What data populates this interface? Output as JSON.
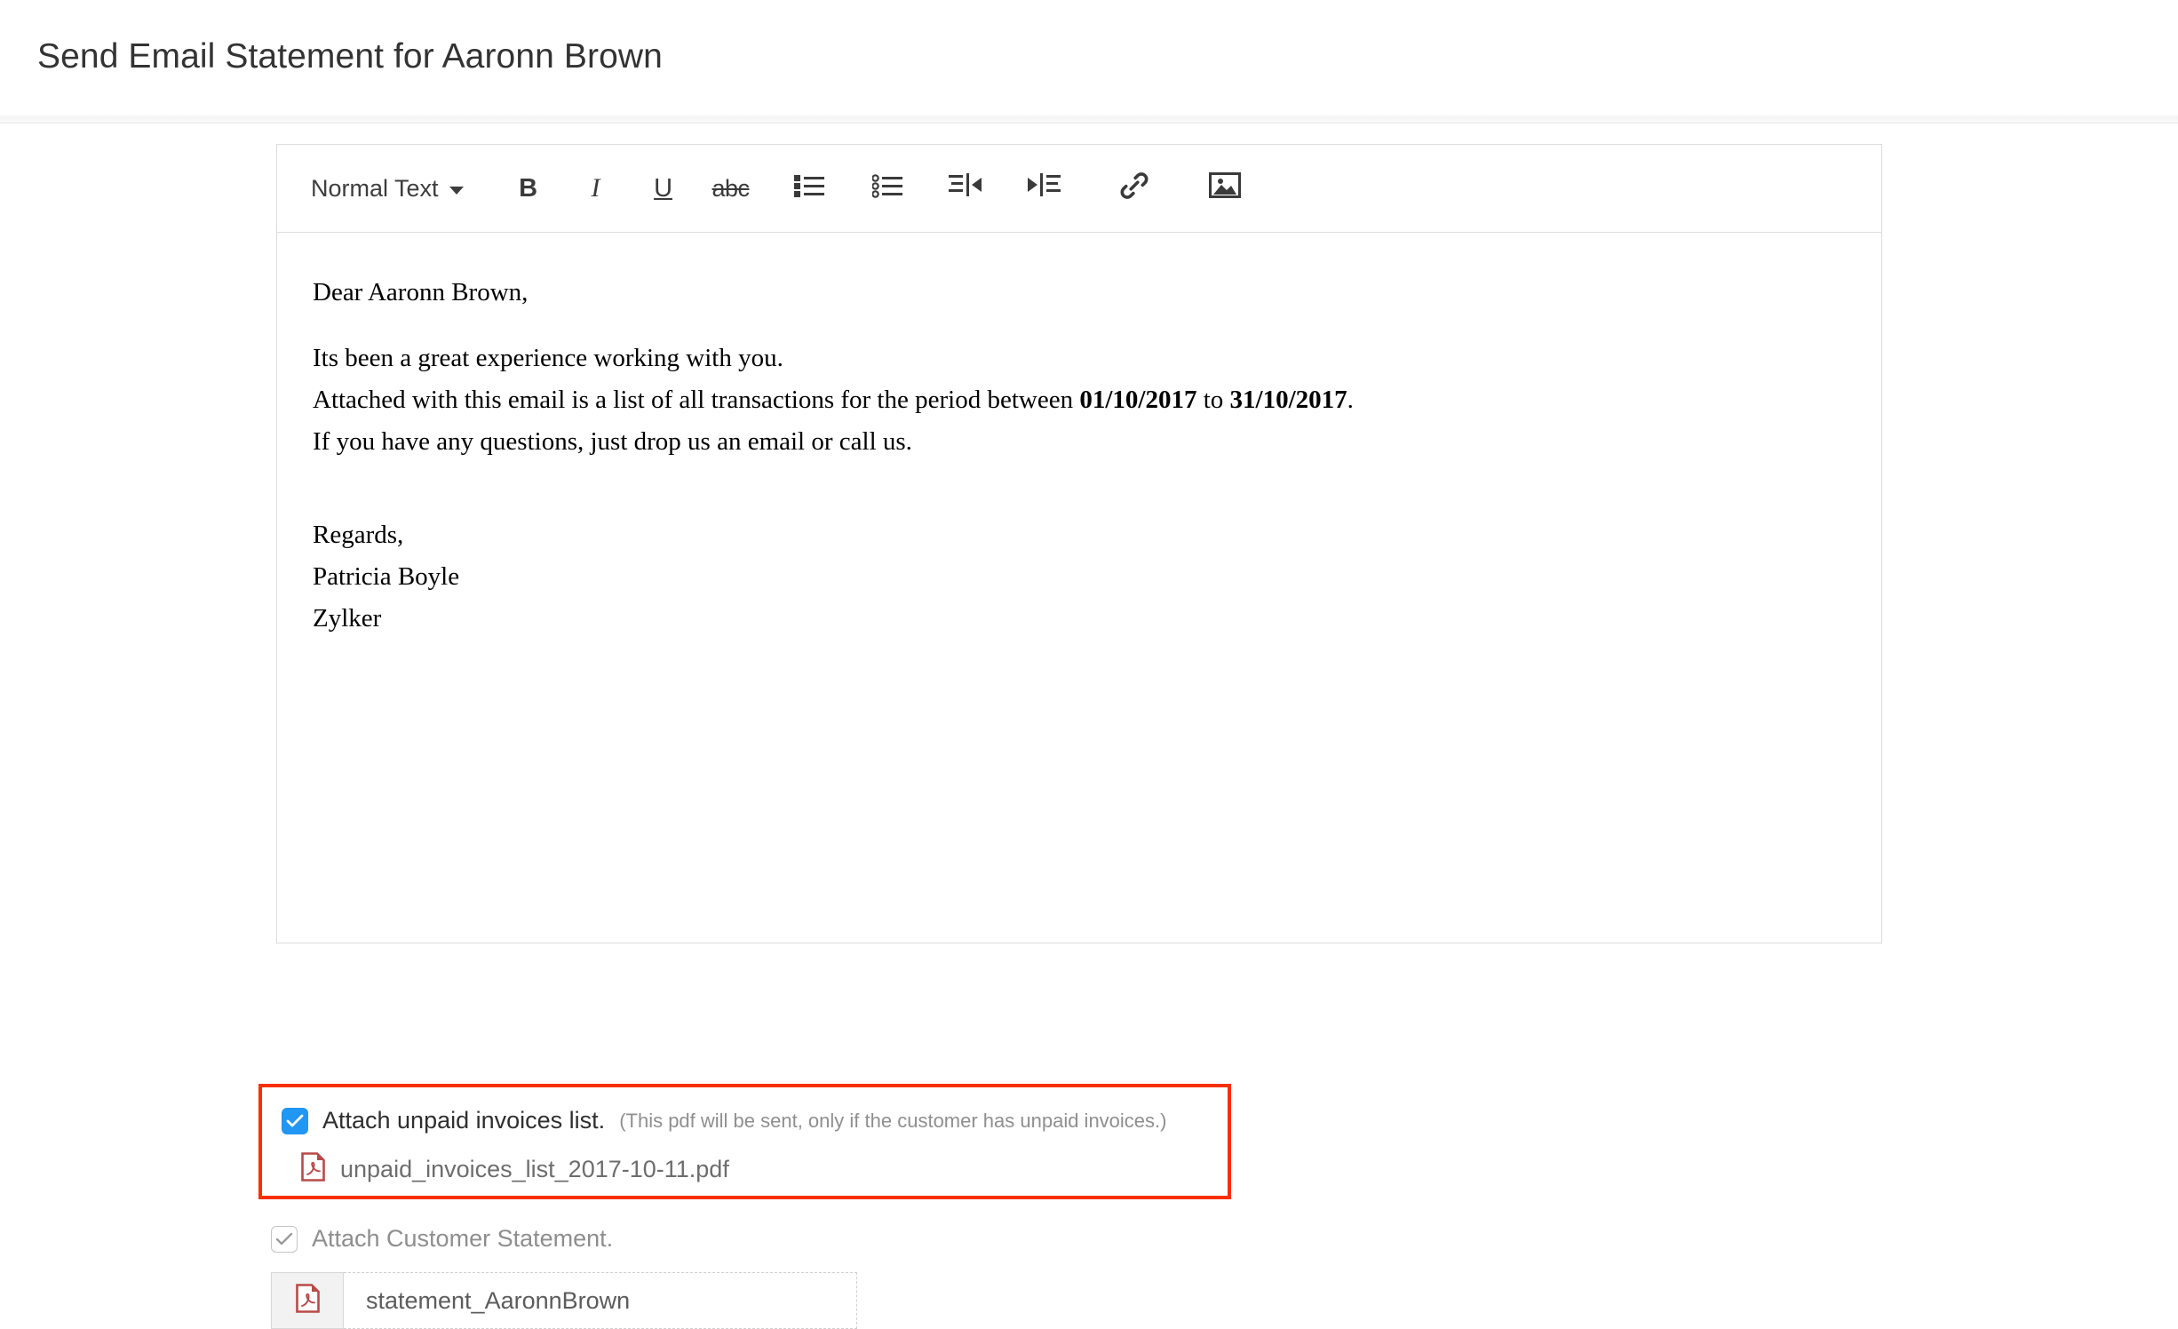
{
  "header": {
    "title": "Send Email Statement for Aaronn Brown"
  },
  "editor": {
    "toolbar": {
      "style_select": "Normal Text",
      "bold": "B",
      "italic": "I",
      "underline": "U",
      "strikethrough": "abc",
      "bullet_list_icon": "bulleted-list-icon",
      "numbered_list_icon": "numbered-list-icon",
      "outdent_icon": "outdent-icon",
      "indent_icon": "indent-icon",
      "link_icon": "link-icon",
      "image_icon": "image-icon"
    },
    "body": {
      "greeting": "Dear Aaronn Brown,",
      "line1": "Its been a great experience working with you.",
      "line2_prefix": "Attached with this email is a list of all transactions for the period between ",
      "date_from": "01/10/2017",
      "line2_mid": " to ",
      "date_to": "31/10/2017",
      "line2_suffix": ".",
      "line3": "If you have any questions, just drop us an email or call us.",
      "sign_off": "Regards,",
      "sender_name": "Patricia Boyle",
      "company": "Zylker"
    }
  },
  "attachments": {
    "unpaid": {
      "checked": true,
      "label": "Attach unpaid invoices list.",
      "hint": "(This pdf will be sent, only if the customer has unpaid invoices.)",
      "file_name": "unpaid_invoices_list_2017-10-11.pdf",
      "file_icon": "pdf-file-icon",
      "highlight_color": "#f83000",
      "checkbox_color": "#2196f3"
    },
    "statement": {
      "checked": true,
      "disabled": true,
      "label": "Attach Customer Statement.",
      "file_name": "statement_AaronnBrown",
      "file_icon": "pdf-file-icon"
    }
  }
}
